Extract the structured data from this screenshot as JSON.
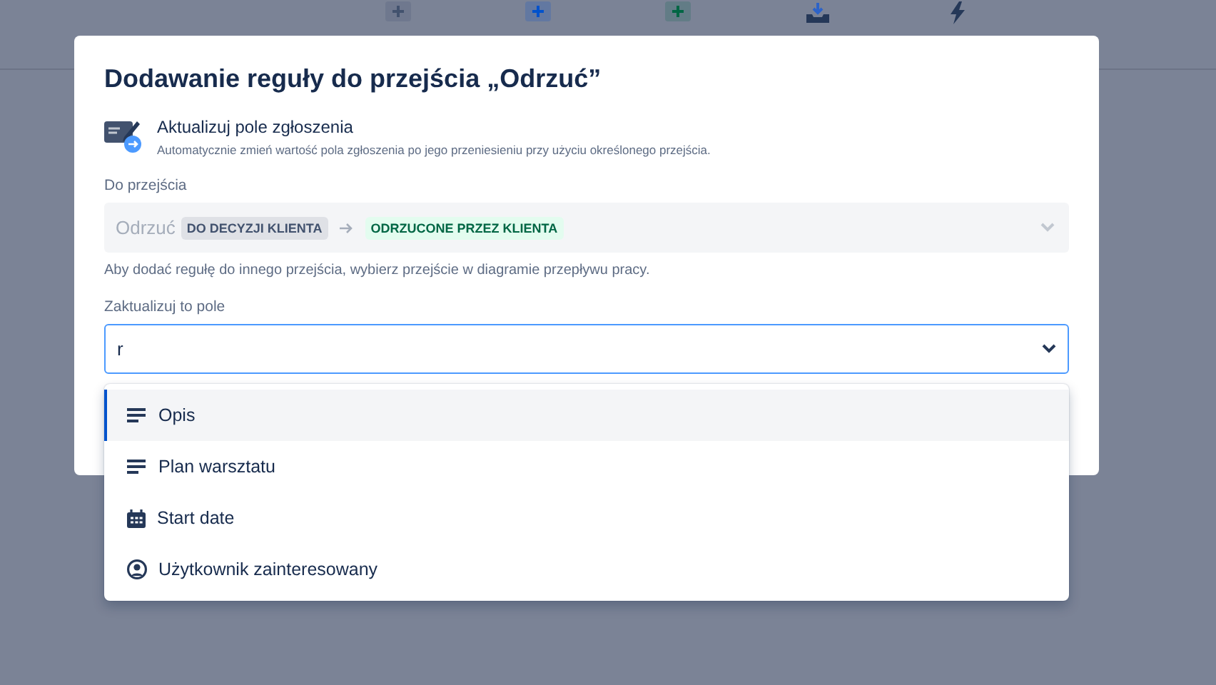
{
  "toolbar": [
    {
      "kind": "plus",
      "color": "#42526e"
    },
    {
      "kind": "plus",
      "color": "#0052cc"
    },
    {
      "kind": "plus",
      "color": "#006644"
    },
    {
      "kind": "import"
    },
    {
      "kind": "bolt"
    }
  ],
  "dialog": {
    "title": "Dodawanie reguły do przejścia „Odrzuć”",
    "rule": {
      "name": "Aktualizuj pole zgłoszenia",
      "description": "Automatycznie zmień wartość pola zgłoszenia po jego przeniesieniu przy użyciu określonego przejścia."
    },
    "transition": {
      "label": "Do przejścia",
      "name": "Odrzuć",
      "from": "DO DECYZJI KLIENTA",
      "to": "ODRZUCONE PRZEZ KLIENTA",
      "help": "Aby dodać regułę do innego przejścia, wybierz przejście w diagramie przepływu pracy."
    },
    "field": {
      "label": "Zaktualizuj to pole",
      "value": "r"
    }
  },
  "menu": [
    {
      "label": "Opis",
      "kind": "text",
      "selected": true
    },
    {
      "label": "Plan warsztatu",
      "kind": "text",
      "selected": false
    },
    {
      "label": "Start date",
      "kind": "date",
      "selected": false
    },
    {
      "label": "Użytkownik zainteresowany",
      "kind": "user",
      "selected": false
    }
  ]
}
